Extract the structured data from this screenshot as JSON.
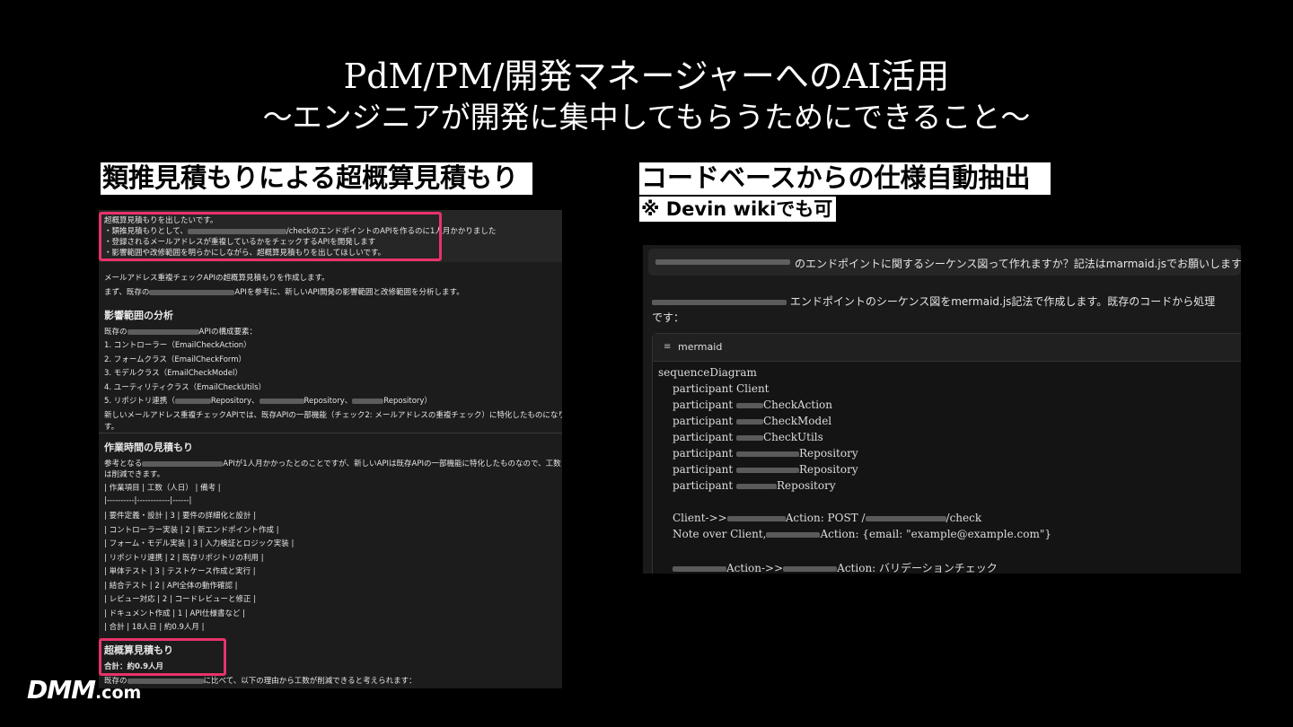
{
  "slide": {
    "title_line1": "PdM/PM/開発マネージャーへのAI活用",
    "title_line2": "～エンジニアが開発に集中してもらうためにできること～"
  },
  "left": {
    "heading": "類推見積もりによる超概算見積もり",
    "prompt_lines": [
      "超概算見積もりを出したいです。",
      "・類推見積もりとして、",
      "/checkのエンドポイントのAPIを作るのに1人月かかりました",
      "・登録されるメールアドレスが重複しているかをチェックするAPIを開発します",
      "・影響範囲や改修範囲を明らかにしながら、超概算見積もりを出してほしいです。"
    ],
    "intro1": "メールアドレス重複チェックAPIの超概算見積もりを作成します。",
    "intro2a": "まず、既存の",
    "intro2b": "APIを参考に、新しいAPI開発の影響範囲と改修範囲を分析します。",
    "impact_heading": "影響範囲の分析",
    "impact_lead_a": "既存の",
    "impact_lead_b": "APIの構成要素：",
    "impact_items": [
      "1. コントローラー（EmailCheckAction）",
      "2. フォームクラス（EmailCheckForm）",
      "3. モデルクラス（EmailCheckModel）",
      "4. ユーティリティクラス（EmailCheckUtils）"
    ],
    "impact_item5_a": "5. リポジトリ連携（",
    "impact_item5_b": "Repository、",
    "impact_item5_c": "Repository、",
    "impact_item5_d": "Repository）",
    "impact_note1": "新しいメールアドレス重複チェックAPIでは、既存APIの一部機能（チェック2: メールアドレスの重複チェック）に特化したものになりま",
    "impact_note2": "す。",
    "work_heading": "作業時間の見積もり",
    "work_lead1a": "参考となる",
    "work_lead1b": "APIが1人月かかったとのことですが、新しいAPIは既存APIの一部機能に特化したものなので、工数",
    "work_lead2": "は削減できます。",
    "table_rows": [
      "| 作業項目 | 工数（人日） | 備考 |",
      "|----------|------------|------|",
      "| 要件定義・設計 | 3 | 要件の詳細化と設計 |",
      "| コントローラー実装 | 2 | 新エンドポイント作成 |",
      "| フォーム・モデル実装 | 3 | 入力検証とロジック実装 |",
      "| リポジトリ連携 | 2 | 既存リポジトリの利用 |",
      "| 単体テスト | 3 | テストケース作成と実行 |",
      "| 結合テスト | 2 | API全体の動作確認 |",
      "| レビュー対応 | 2 | コードレビューと修正 |",
      "| ドキュメント作成 | 1 | API仕様書など |",
      "| 合計 | 18人日 | 約0.9人月 |"
    ],
    "rough_heading": "超概算見積もり",
    "rough_total": "合計：約0.9人月",
    "last_line_a": "既存の",
    "last_line_b": "に比べて、以下の理由から工数が削減できると考えられます："
  },
  "right": {
    "heading1": "コードベースからの仕様自動抽出",
    "heading2": "※ Devin wikiでも可",
    "question": "のエンドポイントに関するシーケンス図って作れますか？記法はmarmaid.jsでお願いします",
    "answer_line1": "エンドポイントのシーケンス図をmermaid.js記法で作成します。既存のコードから処理",
    "answer_line2": "です：",
    "code_lang": "mermaid",
    "code_icon": "≡",
    "code_lines": {
      "l0": "sequenceDiagram",
      "l1": "participant Client",
      "l2a": "participant ",
      "l2b": "CheckAction",
      "l3b": "CheckModel",
      "l4b": "CheckUtils",
      "l5b": "Repository",
      "l6b": "Repository",
      "l7b": "Repository",
      "l8a": "Client->>",
      "l8b": "Action: POST /",
      "l8c": "/check",
      "l9a": "Note over Client,",
      "l9b": "Action: {email: \"example@example.com\"}",
      "l10a": "Action->>",
      "l10b": "Action: バリデーションチェック"
    }
  },
  "logo": {
    "main": "DMM",
    "suffix": ".com"
  }
}
